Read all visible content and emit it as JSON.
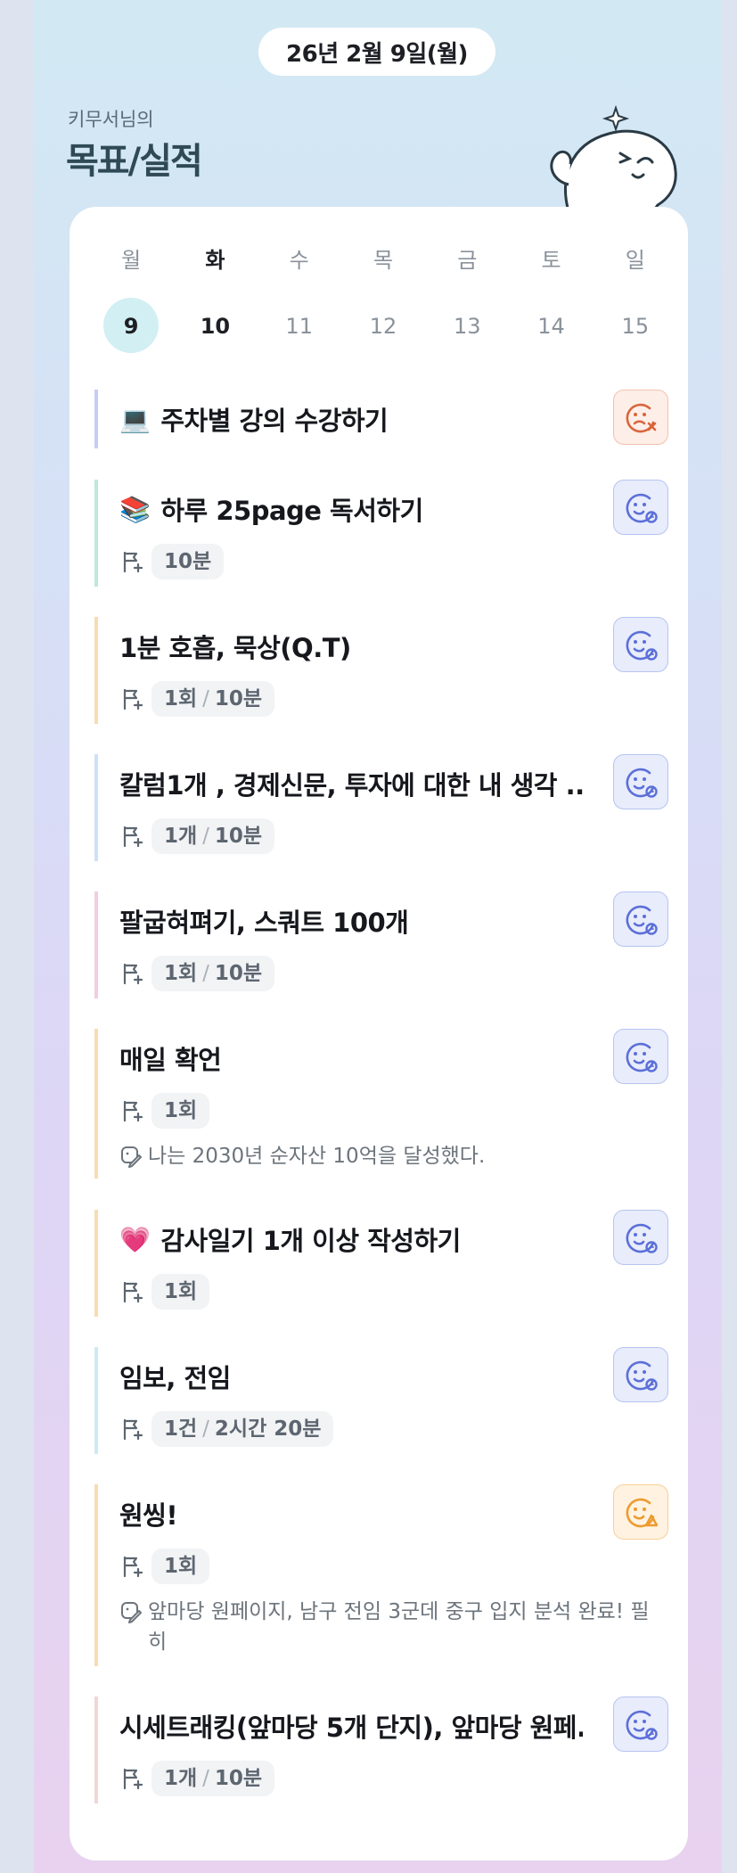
{
  "header": {
    "date": "26년 2월 9일(월)",
    "owner_label": "키무서님의",
    "title": "목표/실적"
  },
  "week": {
    "weekdays": [
      "월",
      "화",
      "수",
      "목",
      "금",
      "토",
      "일"
    ],
    "days": [
      "9",
      "10",
      "11",
      "12",
      "13",
      "14",
      "15"
    ],
    "selected_index": 0,
    "today_index": 1
  },
  "tasks": [
    {
      "emoji": "💻",
      "title": "주차별 강의 수강하기",
      "status": "failed",
      "accent": "#c5cdf5"
    },
    {
      "emoji": "📚",
      "title": "하루 25page 독서하기",
      "badge_a": "10분",
      "badge_b": "",
      "status": "pending",
      "accent": "#bfe8d6"
    },
    {
      "title": "1분 호흡, 묵상(Q.T)",
      "badge_a": "1회",
      "badge_b": "10분",
      "status": "pending",
      "accent": "#f8dcb3"
    },
    {
      "title": "칼럼1개 , 경제신문, 투자에 대한 내 생각 ...",
      "badge_a": "1개",
      "badge_b": "10분",
      "status": "pending",
      "accent": "#cfe0f7"
    },
    {
      "title": "팔굽혀펴기, 스쿼트 100개",
      "badge_a": "1회",
      "badge_b": "10분",
      "status": "pending",
      "accent": "#f2cde2"
    },
    {
      "title": "매일 확언",
      "badge_a": "1회",
      "badge_b": "",
      "note": "나는 2030년 순자산 10억을 달성했다.",
      "status": "pending",
      "accent": "#f8dcb3"
    },
    {
      "emoji": "💗",
      "title": "감사일기 1개 이상 작성하기",
      "badge_a": "1회",
      "badge_b": "",
      "status": "pending",
      "accent": "#f8dcb3"
    },
    {
      "title": "임보, 전임",
      "badge_a": "1건",
      "badge_b": "2시간 20분",
      "status": "pending",
      "accent": "#cdeaf2"
    },
    {
      "title": "원씽!",
      "badge_a": "1회",
      "badge_b": "",
      "note": "앞마당 원페이지, 남구 전임 3군데 중구 입지 분석 완료! 필히",
      "status": "warning",
      "accent": "#f8dcb3"
    },
    {
      "title": "시세트래킹(앞마당 5개 단지), 앞마당 원페...",
      "badge_a": "1개",
      "badge_b": "10분",
      "status": "pending",
      "accent": "#f2d6d6"
    }
  ],
  "icons": {
    "flag": "flag-plus-icon",
    "note": "memo-edit-icon",
    "pending": "smile-clock-icon",
    "failed": "sad-x-icon",
    "warning": "smile-alert-icon"
  },
  "colors": {
    "status_blue": "#5b6fd8",
    "status_red": "#d9653b",
    "status_orange": "#ee9a2e"
  }
}
